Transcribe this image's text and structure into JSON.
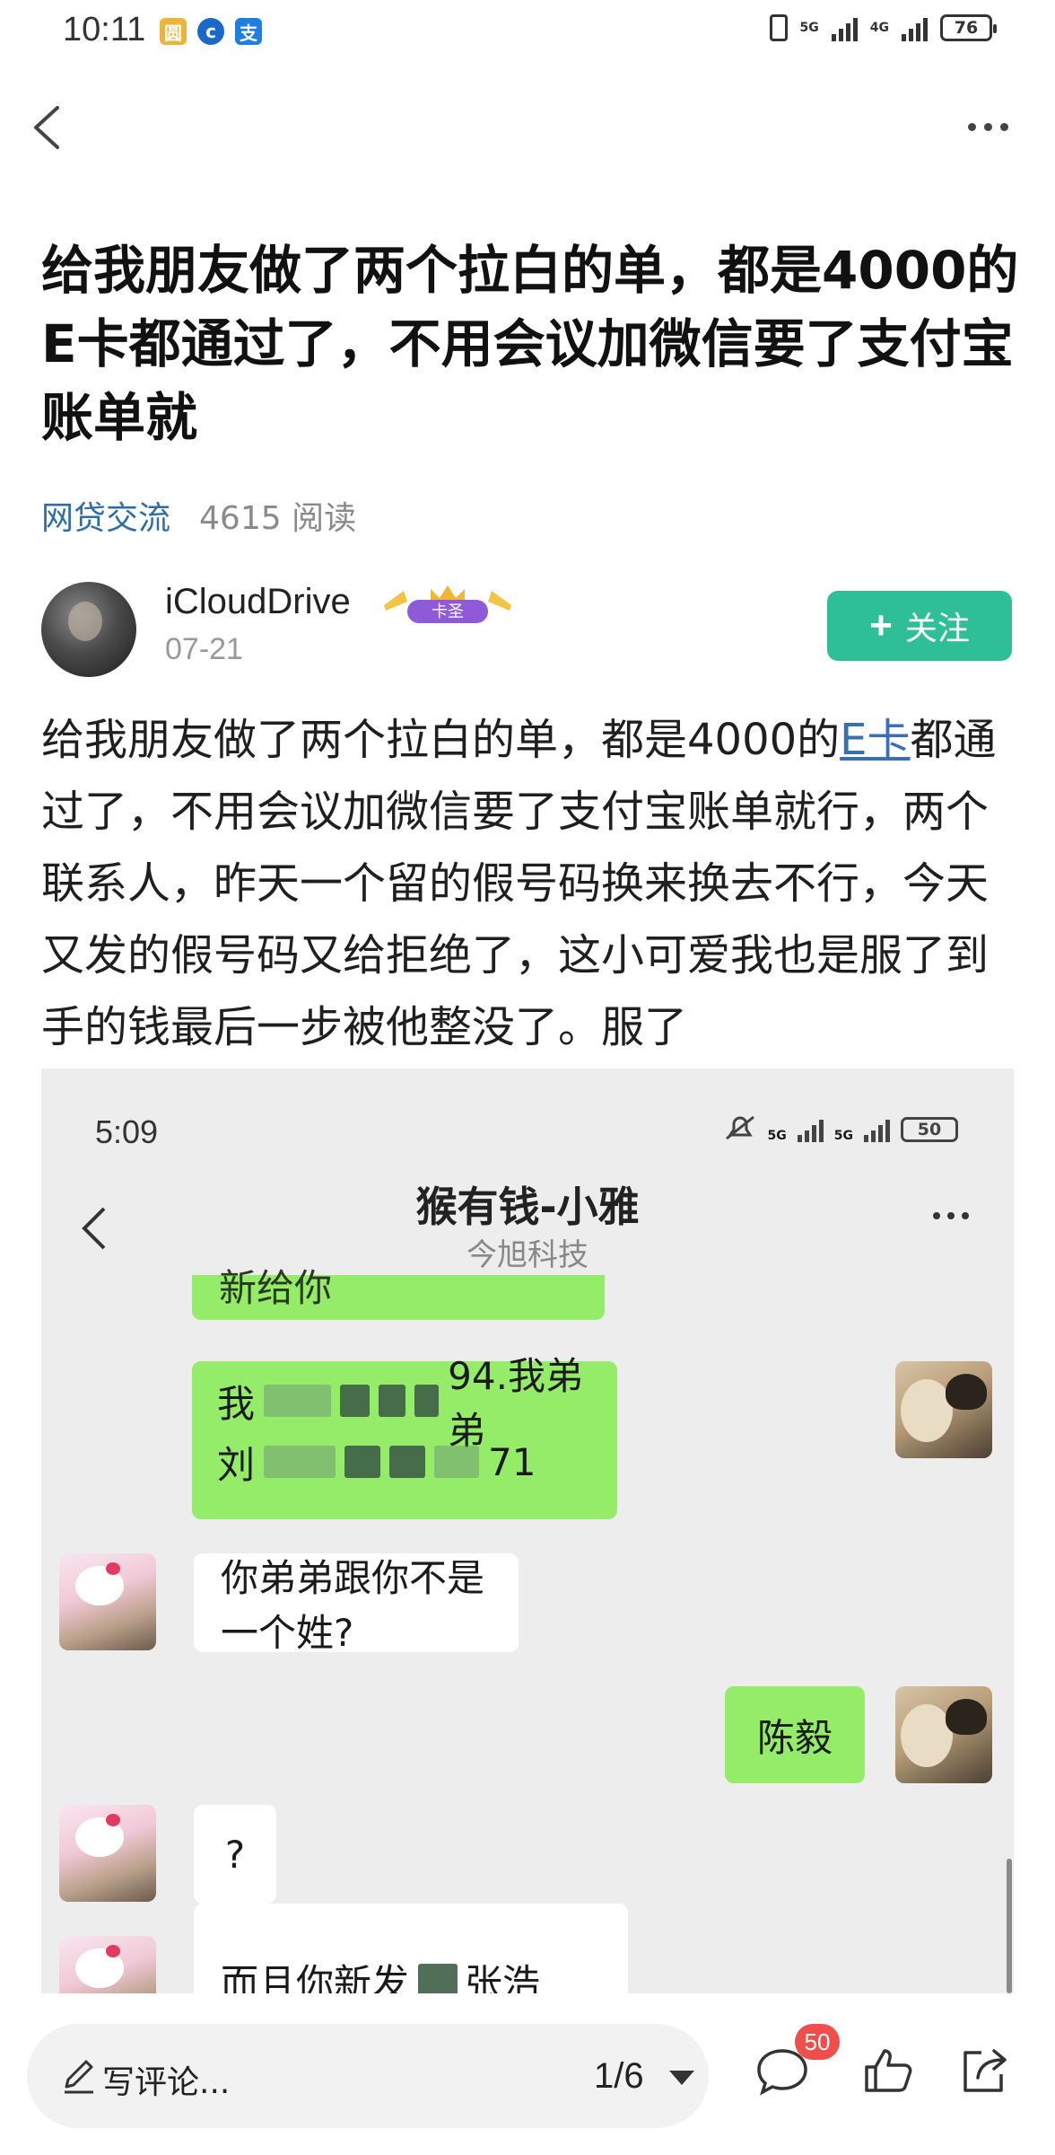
{
  "status_bar": {
    "time": "10:11",
    "battery": "76",
    "net1": "5G",
    "net2": "4G"
  },
  "article": {
    "title": "给我朋友做了两个拉白的单，都是4000的E卡都通过了，不用会议加微信要了支付宝账单就",
    "category": "网贷交流",
    "read_count": "4615 阅读",
    "author": {
      "name": "iCloudDrive",
      "badge": "卡圣",
      "date": "07-21"
    },
    "follow_label": "关注",
    "body_before_link": "给我朋友做了两个拉白的单，都是4000的",
    "body_link": "E卡",
    "body_after_link": "都通过了，不用会议加微信要了支付宝账单就行，两个联系人，昨天一个留的假号码换来换去不行，今天又发的假号码又给拒绝了，这小可爱我也是服了到手的钱最后一步被他整没了。服了"
  },
  "screenshot": {
    "time": "5:09",
    "battery": "50",
    "net": "5G",
    "chat_title": "猴有钱-小雅",
    "chat_subtitle": "今旭科技",
    "messages": [
      {
        "side": "right",
        "text": "新给你"
      },
      {
        "side": "right",
        "line1_prefix": "我",
        "line1_suffix": "94.我弟弟",
        "line2_prefix": "刘",
        "line2_suffix": "71"
      },
      {
        "side": "left",
        "text": "你弟弟跟你不是一个姓?"
      },
      {
        "side": "right",
        "text": "陈毅"
      },
      {
        "side": "left",
        "text": "?"
      },
      {
        "side": "left",
        "text_prefix": "而且你新发",
        "text_suffix": "张浩"
      }
    ]
  },
  "bottom_bar": {
    "comment_placeholder": "写评论...",
    "pager": "1/6",
    "comment_count": "50"
  },
  "colors": {
    "accent": "#2fbf97",
    "link": "#3a6fb5",
    "badge_red": "#ef4e4a",
    "wechat_green": "#95ec69"
  }
}
